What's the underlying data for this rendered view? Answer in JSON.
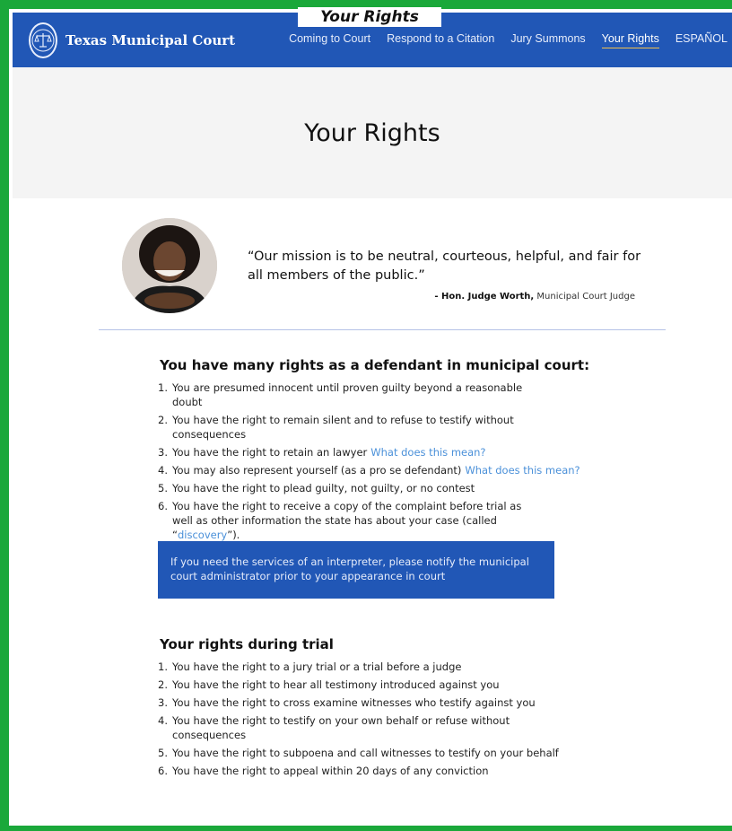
{
  "page_label": "Your Rights",
  "header": {
    "brand": "Texas Municipal Court",
    "nav": [
      {
        "label": "Coming to Court",
        "active": false
      },
      {
        "label": "Respond to a Citation",
        "active": false
      },
      {
        "label": "Jury Summons",
        "active": false
      },
      {
        "label": "Your Rights",
        "active": true
      },
      {
        "label": "ESPAÑOL",
        "active": false
      }
    ]
  },
  "hero": {
    "title": "Your Rights"
  },
  "quote": {
    "text": "“Our mission is to be neutral, courteous, helpful, and fair for all members of the public.”",
    "judge": "- Hon. Judge Worth,",
    "role": "Municipal Court Judge"
  },
  "defendant_rights": {
    "title": "You have many rights as a defendant in municipal court:",
    "items": [
      {
        "num": "1.",
        "text": "You are presumed innocent until proven guilty beyond a reasonable doubt"
      },
      {
        "num": "2.",
        "text": "You have the right to remain silent and to refuse to testify without consequences"
      },
      {
        "num": "3.",
        "text": "You have the right to retain an lawyer",
        "link": "What does this mean?"
      },
      {
        "num": "4.",
        "text": "You may also represent yourself (as a pro se defendant)",
        "link": "What does this mean?"
      },
      {
        "num": "5.",
        "text": "You have the right to plead guilty, not guilty, or no contest"
      },
      {
        "num": "6.",
        "text": "You have the right to receive a copy of the complaint before trial as well as other information the state has about your case (called “",
        "link": "discovery",
        "after": "”)."
      }
    ]
  },
  "callout": {
    "text": "If you need the services of an interpreter, please notify the municipal court administrator prior to your appearance in court"
  },
  "trial_rights": {
    "title": "Your rights during trial",
    "items": [
      {
        "num": "1.",
        "text": "You have the right to a jury trial or a trial before a judge"
      },
      {
        "num": "2.",
        "text": "You have the right to hear all testimony introduced against you"
      },
      {
        "num": "3.",
        "text": "You have the right to cross examine witnesses who testify against you"
      },
      {
        "num": "4.",
        "text": "You have the right to testify on your own behalf or refuse without consequences"
      },
      {
        "num": "5.",
        "text": "You have the right to subpoena and call witnesses to testify on your behalf"
      },
      {
        "num": "6.",
        "text": "You have the right to appeal within 20 days of any conviction"
      }
    ]
  },
  "colors": {
    "nav_bg": "#2157b6",
    "active_underline": "#f2c14e",
    "link": "#4a90d9",
    "frame": "#1aa83a",
    "hero_bg": "#f4f4f4"
  },
  "icons": {
    "logo": "court-seal-icon",
    "avatar": "judge-portrait"
  }
}
